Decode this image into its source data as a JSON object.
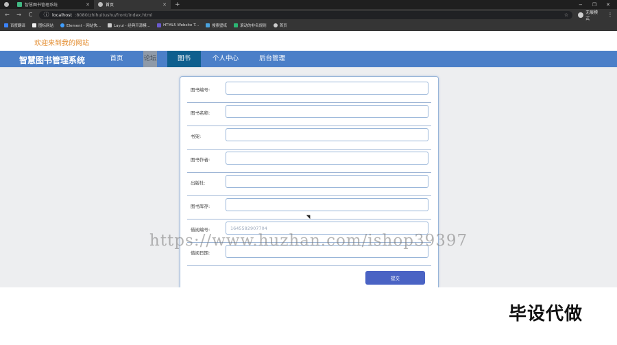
{
  "browser": {
    "tabs": [
      {
        "title": "",
        "active": false
      },
      {
        "title": "智慧图书管理系统",
        "active": false
      },
      {
        "title": "首页",
        "active": true
      }
    ],
    "new_tab": "+",
    "window_controls": {
      "minimize": "−",
      "restore": "❐",
      "close": "✕"
    },
    "nav": {
      "back": "←",
      "forward": "→",
      "reload": "C"
    },
    "url_host": "localhost",
    "url_path": ":8080/zhihuitushu/front/index.html",
    "star": "☆",
    "profile_label": "无痕模式",
    "menu": "⋮",
    "bookmarks": [
      "百度翻译",
      "图标网站",
      "Element - 网站快...",
      "Layui - 经典开源模...",
      "HTML5 Website T...",
      "搜索壁纸",
      "滚动的非名规则",
      "首页"
    ]
  },
  "site": {
    "welcome": "欢迎来到我的网站",
    "logo": "智慧图书管理系统",
    "nav": [
      "首页",
      "论坛",
      "图书",
      "个人中心",
      "后台管理"
    ]
  },
  "form": {
    "fields": [
      {
        "label": "图书编号:",
        "value": "",
        "placeholder": ""
      },
      {
        "label": "图书名称:",
        "value": "",
        "placeholder": ""
      },
      {
        "label": "书架:",
        "value": "",
        "placeholder": ""
      },
      {
        "label": "图书作者:",
        "value": "",
        "placeholder": ""
      },
      {
        "label": "出版社:",
        "value": "",
        "placeholder": ""
      },
      {
        "label": "图书库存:",
        "value": "",
        "placeholder": ""
      },
      {
        "label": "借阅编号:",
        "value": "1645582907704",
        "placeholder": ""
      },
      {
        "label": "借阅日期:",
        "value": "",
        "placeholder": ""
      }
    ],
    "submit": "提交"
  },
  "overlay": {
    "watermark": "https://www.huzhan.com/ishop39397",
    "caption": "毕设代做"
  },
  "colors": {
    "nav_bg": "#4b7fc8",
    "nav_active": "#0f5f8e",
    "welcome": "#e38b2c",
    "submit": "#4a63c4"
  }
}
